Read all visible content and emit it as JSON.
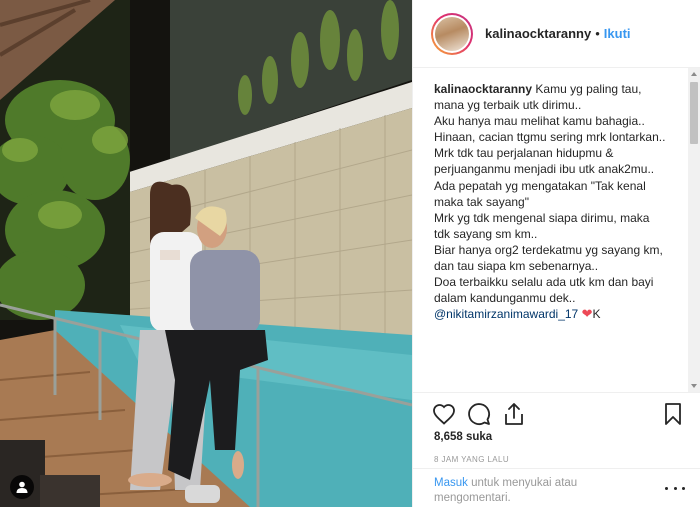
{
  "post": {
    "username": "kalinaocktaranny",
    "separator": "•",
    "follow_label": "Ikuti",
    "caption": {
      "username": "kalinaocktaranny",
      "lines": [
        "Kamu yg paling tau,",
        "mana yg terbaik utk dirimu..",
        "Aku hanya mau melihat kamu bahagia..",
        "Hinaan, cacian ttgmu sering mrk lontarkan..",
        "Mrk tdk tau perjalanan hidupmu &",
        "perjuanganmu menjadi ibu utk anak2mu..",
        "Ada pepatah yg mengatakan \"Tak kenal",
        "maka tak sayang\"",
        "Mrk yg tdk mengenal siapa dirimu, maka",
        "tdk sayang sm km..",
        "Biar hanya org2 terdekatmu yg sayang km,",
        "dan tau siapa km sebenarnya..",
        "Doa terbaikku selalu ada utk km dan bayi",
        "dalam kandunganmu dek.."
      ],
      "mention": "@nikitamirzanimawardi_17",
      "heart": "❤",
      "suffix": "K"
    },
    "likes_text": "8,658 suka",
    "timestamp": "8 JAM YANG LALU",
    "login": {
      "link_label": "Masuk",
      "text": " untuk menyukai atau mengomentari."
    }
  },
  "icons": {
    "like": "heart-outline-icon",
    "comment": "comment-bubble-icon",
    "share": "share-icon",
    "save": "bookmark-icon",
    "more": "more-options-icon",
    "user_tag": "user-tag-icon"
  },
  "colors": {
    "link_blue": "#3897f0",
    "mention_blue": "#003569",
    "heart_red": "#ed4956",
    "muted_text": "#999999",
    "text": "#262626",
    "divider": "#efefef"
  }
}
